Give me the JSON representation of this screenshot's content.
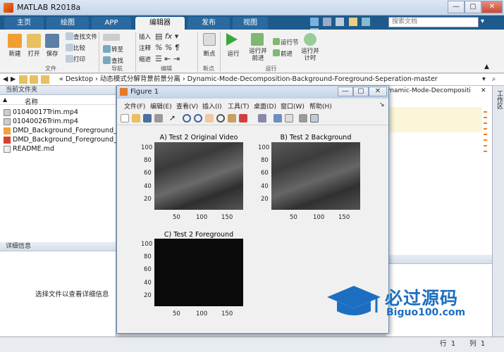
{
  "app": {
    "title": "MATLAB R2018a"
  },
  "window_controls": {
    "minimize": "—",
    "maximize": "▢",
    "close": "✕"
  },
  "tabs": [
    "主页",
    "绘图",
    "APP",
    "编辑器",
    "发布",
    "视图"
  ],
  "active_tab": "编辑器",
  "search": {
    "placeholder": "搜索文档"
  },
  "ribbon": {
    "new": "新建",
    "open": "打开",
    "save": "保存",
    "find_files": "查找文件",
    "compare": "比较",
    "print": "打印",
    "goto": "转至",
    "find": "查找",
    "insert": "插入",
    "comment": "注释",
    "indent": "缩进",
    "breakpoints": "断点",
    "run": "运行",
    "run_advance": "运行并\n前进",
    "run_section": "运行节",
    "advance": "前进",
    "run_time": "运行并\n计时",
    "groups": {
      "file": "文件",
      "navigate": "导航",
      "edit": "编辑",
      "breakpoints": "断点",
      "run": "运行"
    }
  },
  "address": {
    "path": "« Desktop › 动态模式分解背景前景分离 › Dynamic-Mode-Decomposition-Background-Foreground-Seperation-master"
  },
  "current_folder": {
    "header": "当前文件夹",
    "column_name": "名称",
    "files": [
      "01040017Trim.mp4",
      "01040026Trim.mp4",
      "DMD_Background_Foreground_Se",
      "DMD_Background_Foreground_Se",
      "README.md"
    ]
  },
  "details": {
    "header": "详细信息",
    "empty_text": "选择文件以查看详细信息"
  },
  "right_tab": {
    "label": "ynamic-Mode-Decompositi"
  },
  "status": {
    "row_label": "行",
    "row": "1",
    "col_label": "列",
    "col": "1"
  },
  "figure": {
    "title": "Figure 1",
    "menus": [
      "文件(F)",
      "编辑(E)",
      "查看(V)",
      "插入(I)",
      "工具(T)",
      "桌面(D)",
      "窗口(W)",
      "帮助(H)"
    ],
    "axes": [
      {
        "title": "A) Test 2 Original Video",
        "yticks": [
          "100",
          "80",
          "60",
          "40",
          "20"
        ],
        "xticks": [
          "50",
          "100",
          "150"
        ]
      },
      {
        "title": "B) Test 2 Background",
        "yticks": [
          "100",
          "80",
          "60",
          "40",
          "20"
        ],
        "xticks": [
          "50",
          "100",
          "150"
        ]
      },
      {
        "title": "C) Test 2 Foreground",
        "yticks": [
          "100",
          "80",
          "60",
          "40",
          "20"
        ],
        "xticks": [
          "50",
          "100",
          "150"
        ]
      }
    ]
  },
  "side_label": "工作区",
  "watermark": {
    "name": "必过源码",
    "url": "Biguo100.com"
  },
  "colors": {
    "ribbon_tab": "#1f5a8c",
    "orange_marks": "#f08020"
  }
}
